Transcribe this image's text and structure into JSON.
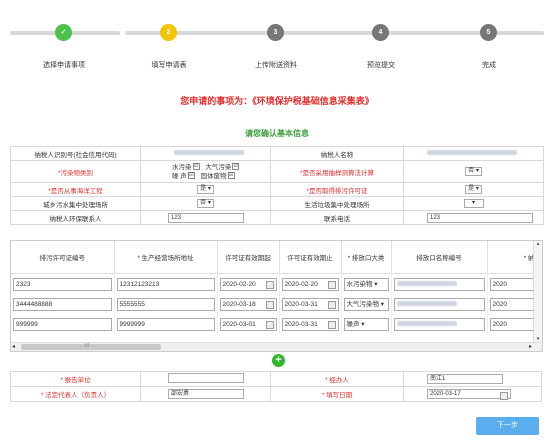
{
  "steps": [
    {
      "num": "✓",
      "label": "选择申请事项",
      "color": "#4cc24c"
    },
    {
      "num": "2",
      "label": "填写申请表",
      "color": "#f5c400"
    },
    {
      "num": "3",
      "label": "上传附送资料",
      "color": "#777777"
    },
    {
      "num": "4",
      "label": "预览提交",
      "color": "#777777"
    },
    {
      "num": "5",
      "label": "完成",
      "color": "#777777"
    }
  ],
  "notice": "您申请的事项为：《环境保护税基础信息采集表》",
  "section_title": "请您确认基本信息",
  "info": {
    "taxpayer_id_label": "纳税人识别号(社会信用代码)",
    "taxpayer_name_label": "纳税人名称",
    "pollutant_type_label": "*污染物类别",
    "pollutant_options": [
      "水污染",
      "大气污染",
      "噪 声",
      "固体废物"
    ],
    "pollutant_checks": [
      "☑",
      "☑",
      "☑",
      "☑"
    ],
    "coeff_label": "*是否采用抽样测算法计算",
    "coeff_value": "否",
    "sea_label": "*是否从事海洋工程",
    "sea_value": "是",
    "permit_label": "*是否取得排污许可证",
    "permit_value": "是",
    "sewage_label": "城乡污水集中处理场所",
    "sewage_value": "否",
    "garbage_label": "生活垃圾集中处理场所",
    "garbage_value": "",
    "contact_label": "纳税人环保联系人",
    "contact_value": "123",
    "phone_label": "联系电话",
    "phone_value": "123"
  },
  "grid": {
    "headers": [
      "排污许可证编号",
      "* 生产经营场所地址",
      "许可证有效期起",
      "许可证有效期止",
      "* 排放口大类",
      "排放口名称编号",
      "* 纳"
    ],
    "rows": [
      {
        "permit": "2323",
        "addr": "12312123213",
        "start": "2020-02-20",
        "end": "2020-02-20",
        "kind": "水污染物",
        "tail": "2020"
      },
      {
        "permit": "3444488888",
        "addr": "5555555",
        "start": "2020-03-18",
        "end": "2020-03-31",
        "kind": "大气污染物",
        "tail": "2020"
      },
      {
        "permit": "999999",
        "addr": "9999999",
        "start": "2020-03-01",
        "end": "2020-03-31",
        "kind": "噪声",
        "tail": "2020"
      }
    ],
    "scroll_glyph": "III",
    "scroll_left": "◂",
    "scroll_right": "▸",
    "scroll_up": "▴",
    "scroll_down": "▾"
  },
  "add_icon": "+",
  "bottom": {
    "report_unit_label": "* 报告单位",
    "report_unit_value": "",
    "handler_label": "* 经办人",
    "handler_value": "南江1",
    "legal_label": "* 法定代表人（负责人）",
    "legal_value": "邵宏勇",
    "fill_date_label": "* 填写日期",
    "fill_date_value": "2020-03-17"
  },
  "next_label": "下一步"
}
